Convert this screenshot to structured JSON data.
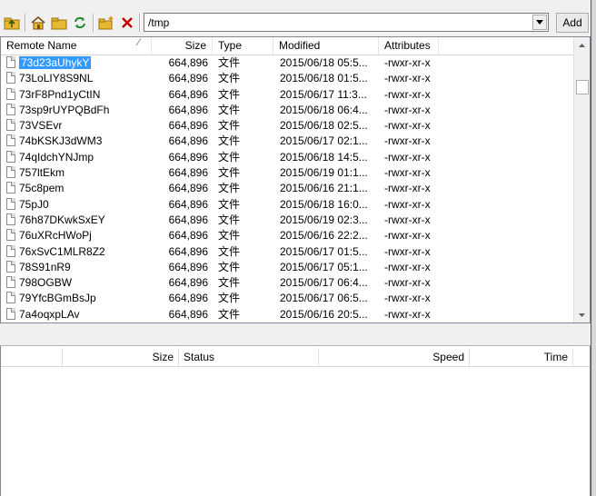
{
  "toolbar": {
    "path": "/tmp",
    "add_label": "Add",
    "icons": [
      "folder-up-icon",
      "home-icon",
      "folder-icon",
      "refresh-icon",
      "new-folder-icon",
      "delete-icon"
    ]
  },
  "list": {
    "columns": [
      "Remote Name",
      "Size",
      "Type",
      "Modified",
      "Attributes"
    ],
    "rows": [
      {
        "name": "73d23aUhykY",
        "size": "664,896",
        "type": "文件",
        "modified": "2015/06/18 05:5...",
        "attributes": "-rwxr-xr-x"
      },
      {
        "name": "73LoLIY8S9NL",
        "size": "664,896",
        "type": "文件",
        "modified": "2015/06/18 01:5...",
        "attributes": "-rwxr-xr-x"
      },
      {
        "name": "73rF8Pnd1yCtIN",
        "size": "664,896",
        "type": "文件",
        "modified": "2015/06/17 11:3...",
        "attributes": "-rwxr-xr-x"
      },
      {
        "name": "73sp9rUYPQBdFh",
        "size": "664,896",
        "type": "文件",
        "modified": "2015/06/18 06:4...",
        "attributes": "-rwxr-xr-x"
      },
      {
        "name": "73VSEvr",
        "size": "664,896",
        "type": "文件",
        "modified": "2015/06/18 02:5...",
        "attributes": "-rwxr-xr-x"
      },
      {
        "name": "74bKSKJ3dWM3",
        "size": "664,896",
        "type": "文件",
        "modified": "2015/06/17 02:1...",
        "attributes": "-rwxr-xr-x"
      },
      {
        "name": "74qIdchYNJmp",
        "size": "664,896",
        "type": "文件",
        "modified": "2015/06/18 14:5...",
        "attributes": "-rwxr-xr-x"
      },
      {
        "name": "757ltEkm",
        "size": "664,896",
        "type": "文件",
        "modified": "2015/06/19 01:1...",
        "attributes": "-rwxr-xr-x"
      },
      {
        "name": "75c8pem",
        "size": "664,896",
        "type": "文件",
        "modified": "2015/06/16 21:1...",
        "attributes": "-rwxr-xr-x"
      },
      {
        "name": "75pJ0",
        "size": "664,896",
        "type": "文件",
        "modified": "2015/06/18 16:0...",
        "attributes": "-rwxr-xr-x"
      },
      {
        "name": "76h87DKwkSxEY",
        "size": "664,896",
        "type": "文件",
        "modified": "2015/06/19 02:3...",
        "attributes": "-rwxr-xr-x"
      },
      {
        "name": "76uXRcHWoPj",
        "size": "664,896",
        "type": "文件",
        "modified": "2015/06/16 22:2...",
        "attributes": "-rwxr-xr-x"
      },
      {
        "name": "76xSvC1MLR8Z2",
        "size": "664,896",
        "type": "文件",
        "modified": "2015/06/17 01:5...",
        "attributes": "-rwxr-xr-x"
      },
      {
        "name": "78S91nR9",
        "size": "664,896",
        "type": "文件",
        "modified": "2015/06/17 05:1...",
        "attributes": "-rwxr-xr-x"
      },
      {
        "name": "798OGBW",
        "size": "664,896",
        "type": "文件",
        "modified": "2015/06/17 06:4...",
        "attributes": "-rwxr-xr-x"
      },
      {
        "name": "79YfcBGmBsJp",
        "size": "664,896",
        "type": "文件",
        "modified": "2015/06/17 06:5...",
        "attributes": "-rwxr-xr-x"
      },
      {
        "name": "7a4oqxpLAv",
        "size": "664,896",
        "type": "文件",
        "modified": "2015/06/16 20:5...",
        "attributes": "-rwxr-xr-x"
      }
    ]
  },
  "queue": {
    "columns": [
      "Size",
      "Status",
      "Speed",
      "Time"
    ]
  },
  "colors": {
    "selection": "#3399ff",
    "delete": "#c00000",
    "folder": "#e8b930"
  }
}
